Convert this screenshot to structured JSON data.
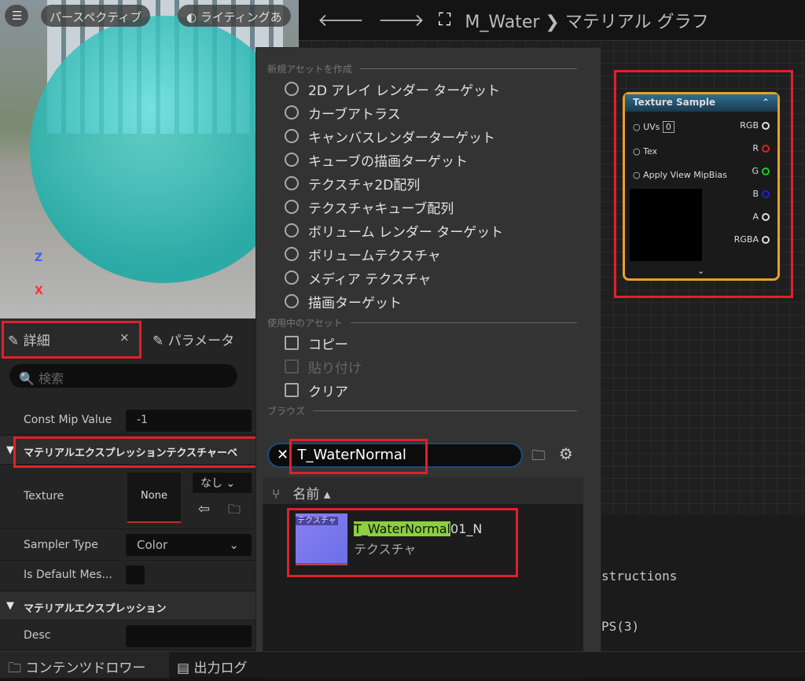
{
  "viewport": {
    "menu_icon": "hamburger-icon",
    "perspective": "パースペクティブ",
    "lighting": "ライティングあ",
    "axis_z": "Z",
    "axis_x": "X"
  },
  "toolbar": {
    "back_icon": "arrow-left-icon",
    "forward_icon": "arrow-right-icon",
    "graph_icon": "graph-icon",
    "asset": "M_Water",
    "sep": "❯",
    "graph": "マテリアル グラフ"
  },
  "menu": {
    "create_header": "新規アセットを作成",
    "create_items": [
      {
        "label": "2D アレイ レンダー ターゲット",
        "icon": "cube-icon"
      },
      {
        "label": "カーブアトラス",
        "icon": "checker-icon"
      },
      {
        "label": "キャンバスレンダーターゲット",
        "icon": "checker-icon"
      },
      {
        "label": "キューブの描画ターゲット",
        "icon": "cube-checker-icon"
      },
      {
        "label": "テクスチャ2D配列",
        "icon": "cube-icon"
      },
      {
        "label": "テクスチャキューブ配列",
        "icon": "cube-icon"
      },
      {
        "label": "ボリューム レンダー ターゲット",
        "icon": "cube-icon"
      },
      {
        "label": "ボリュームテクスチャ",
        "icon": "cube-icon"
      },
      {
        "label": "メディア テクスチャ",
        "icon": "tv-icon"
      },
      {
        "label": "描画ターゲット",
        "icon": "checker-icon"
      }
    ],
    "current_header": "使用中のアセット",
    "copy": "コピー",
    "paste": "貼り付け",
    "clear": "クリア",
    "browse_header": "ブラウズ",
    "search_value": "T_WaterNormal",
    "column_name": "名前",
    "result": {
      "thumb_label": "テクスチャ",
      "name_match": "T_WaterNormal",
      "name_rest": "01_N",
      "type": "テクスチャ"
    }
  },
  "details": {
    "tab": "詳細",
    "tab_close": "×",
    "tab2": "パラメータ",
    "search_placeholder": "検索",
    "const_mip_label": "Const Mip Value",
    "const_mip_value": "-1",
    "category1": "マテリアルエクスプレッションテクスチャーベ",
    "texture_label": "Texture",
    "texture_value": "None",
    "texture_dropdown": "なし",
    "sampler_label": "Sampler Type",
    "sampler_value": "Color",
    "default_mesh_label": "Is Default Mes...",
    "category2": "マテリアルエクスプレッション",
    "desc_label": "Desc"
  },
  "node": {
    "title": "Texture Sample",
    "inputs": [
      "UVs",
      "Tex",
      "Apply View MipBias"
    ],
    "uv_value": "0",
    "outputs": [
      {
        "label": "RGB",
        "color": "#dddddd"
      },
      {
        "label": "R",
        "color": "#e02020"
      },
      {
        "label": "G",
        "color": "#20d020"
      },
      {
        "label": "B",
        "color": "#2020d0"
      },
      {
        "label": "A",
        "color": "#dddddd"
      },
      {
        "label": "RGBA",
        "color": "#dddddd"
      }
    ]
  },
  "stats": {
    "line1": "structions",
    "line2": "PS(3)"
  },
  "bottom": {
    "content_drawer": "コンテンツドロワー",
    "output_log": "出力ログ"
  }
}
